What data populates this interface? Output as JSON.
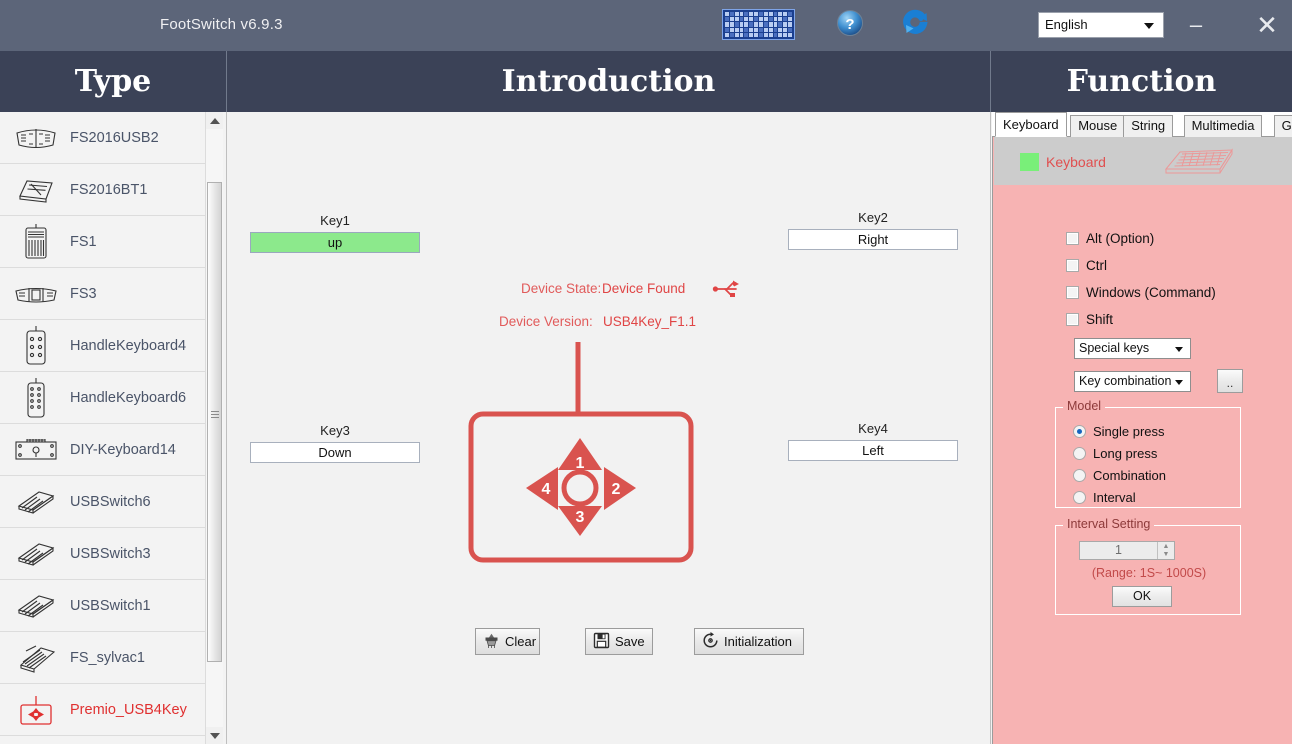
{
  "titlebar": {
    "app_title": "FootSwitch v6.9.3",
    "keyboard_icon": "keyboard-icon",
    "help_icon": "help-icon",
    "refresh_icon": "refresh-icon",
    "language": "English",
    "minimize_label": "–",
    "close_label": "✕"
  },
  "header": {
    "type": "Type",
    "introduction": "Introduction",
    "function": "Function"
  },
  "sidebar": {
    "items": [
      {
        "label": "FS2016USB2",
        "icon": "footswitch-2pedal-icon",
        "selected": false
      },
      {
        "label": "FS2016BT1",
        "icon": "footswitch-bt-icon",
        "selected": false
      },
      {
        "label": "FS1",
        "icon": "footswitch-single-icon",
        "selected": false
      },
      {
        "label": "FS3",
        "icon": "footswitch-3pedal-icon",
        "selected": false
      },
      {
        "label": "HandleKeyboard4",
        "icon": "handle-keypad4-icon",
        "selected": false
      },
      {
        "label": "HandleKeyboard6",
        "icon": "handle-keypad6-icon",
        "selected": false
      },
      {
        "label": "DIY-Keyboard14",
        "icon": "diy-board-icon",
        "selected": false
      },
      {
        "label": "USBSwitch6",
        "icon": "usb-switch-icon",
        "selected": false
      },
      {
        "label": "USBSwitch3",
        "icon": "usb-switch-icon",
        "selected": false
      },
      {
        "label": "USBSwitch1",
        "icon": "usb-switch-icon",
        "selected": false
      },
      {
        "label": "FS_sylvac1",
        "icon": "sylvac-pedal-icon",
        "selected": false
      },
      {
        "label": "Premio_USB4Key",
        "icon": "usb4key-icon",
        "selected": true
      }
    ],
    "selected_color": "#e03030"
  },
  "center": {
    "device_state_label": "Device State:",
    "device_state_value": "Device Found",
    "usb_icon": "usb-icon",
    "device_version_label": "Device Version:",
    "device_version_value": "USB4Key_F1.1",
    "accent_color": "#d9534f",
    "diagram": {
      "arrow_up": "1",
      "arrow_right": "2",
      "arrow_down": "3",
      "arrow_left": "4"
    },
    "keys": [
      {
        "name": "Key1",
        "value": "up",
        "active": true
      },
      {
        "name": "Key2",
        "value": "Right",
        "active": false
      },
      {
        "name": "Key3",
        "value": "Down",
        "active": false
      },
      {
        "name": "Key4",
        "value": "Left",
        "active": false
      }
    ],
    "buttons": {
      "clear": "Clear",
      "save": "Save",
      "initialization": "Initialization"
    }
  },
  "function": {
    "tabs": [
      {
        "label": "Keyboard",
        "active": true
      },
      {
        "label": "Mouse",
        "active": false
      },
      {
        "label": "String",
        "active": false
      },
      {
        "label": "Multimedia",
        "active": false
      },
      {
        "label": "Game",
        "active": false
      }
    ],
    "panel_title": "Keyboard",
    "panel_icon": "keyboard-illustration-icon",
    "status_square_color": "#79ef79",
    "checkboxes": [
      {
        "label": "Alt (Option)",
        "checked": false
      },
      {
        "label": "Ctrl",
        "checked": false
      },
      {
        "label": "Windows (Command)",
        "checked": false
      },
      {
        "label": "Shift",
        "checked": false
      }
    ],
    "special_keys_value": "Special keys",
    "key_combination_value": "Key combination",
    "more_button": "..",
    "model": {
      "title": "Model",
      "options": [
        {
          "label": "Single press",
          "selected": true
        },
        {
          "label": "Long press",
          "selected": false
        },
        {
          "label": "Combination",
          "selected": false
        },
        {
          "label": "Interval",
          "selected": false
        }
      ]
    },
    "interval": {
      "title": "Interval Setting",
      "value": "1",
      "range_text": "(Range: 1S~ 1000S)",
      "ok": "OK"
    }
  }
}
